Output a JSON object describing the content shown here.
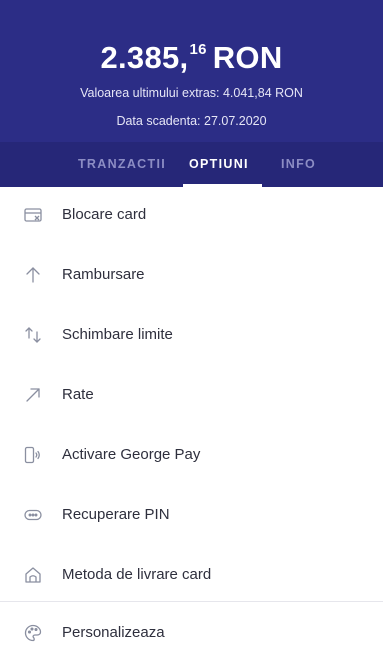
{
  "header": {
    "balance_integer": "2.385,",
    "balance_decimal": "16",
    "currency": "RON",
    "last_statement": "Valoarea ultimului extras: 4.041,84 RON",
    "due_date": "Data scadenta: 27.07.2020"
  },
  "tabs": [
    {
      "label": "TRANZACTII"
    },
    {
      "label": "OPTIUNI"
    },
    {
      "label": "INFO"
    }
  ],
  "active_tab": "OPTIUNI",
  "colors": {
    "header_bg": "#2c2d86",
    "tab_bar_bg": "#262778",
    "icon": "#8a8fa0"
  },
  "menu": [
    {
      "label": "Blocare card",
      "icon": "card-block-icon"
    },
    {
      "label": "Rambursare",
      "icon": "arrow-up-icon"
    },
    {
      "label": "Schimbare limite",
      "icon": "up-down-arrows-icon"
    },
    {
      "label": "Rate",
      "icon": "arrow-up-right-icon"
    },
    {
      "label": "Activare George Pay",
      "icon": "phone-nfc-icon"
    },
    {
      "label": "Recuperare PIN",
      "icon": "pin-dots-icon"
    },
    {
      "label": "Metoda de livrare card",
      "icon": "home-icon"
    },
    {
      "label": "Personalizeaza",
      "icon": "palette-icon"
    }
  ]
}
